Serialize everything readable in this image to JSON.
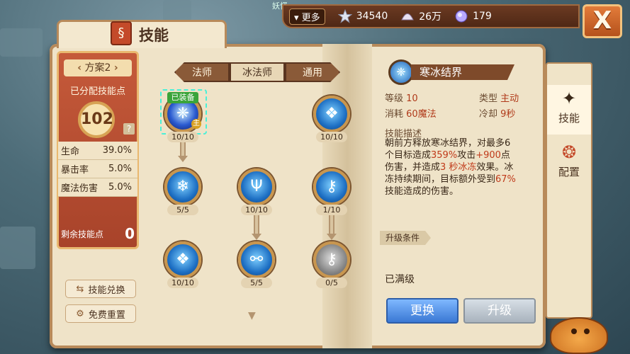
{
  "topbar": {
    "top_label": "妖怪",
    "more_label": "更多",
    "star_value": "34540",
    "shell_value": "26万",
    "gem_value": "179"
  },
  "window": {
    "title": "技能",
    "close_label": "X"
  },
  "left": {
    "plan_label": "方案2",
    "assigned_label": "已分配技能点",
    "assigned_points": "102",
    "help_label": "?",
    "stats": [
      {
        "name": "生命",
        "value": "39.0%"
      },
      {
        "name": "暴击率",
        "value": "5.0%"
      },
      {
        "name": "魔法伤害",
        "value": "5.0%"
      }
    ],
    "remaining_label": "剩余技能点",
    "remaining_value": "0",
    "exchange_label": "技能兑换",
    "reset_label": "免费重置"
  },
  "tabs": [
    "法师",
    "冰法师",
    "通用"
  ],
  "tree": {
    "equipped_tag": "已装备",
    "main_tag": "主",
    "levels": [
      "10/10",
      "10/10",
      "5/5",
      "10/10",
      "1/10",
      "10/10",
      "5/5",
      "0/5"
    ]
  },
  "detail": {
    "name": "寒冰结界",
    "level_label": "等级",
    "level_value": "10",
    "type_label": "类型",
    "type_value": "主动",
    "cost_label": "消耗",
    "cost_value": "60魔法",
    "cooldown_label": "冷却",
    "cooldown_value": "9秒",
    "desc_title": "技能描述",
    "desc_parts": {
      "p1": "朝前方释放寒冰结界，对最多6个目标造成",
      "r1": "359%",
      "p2": "攻击",
      "r2": "+900",
      "p3": "点伤害，并造成",
      "r3": "3 秒冰冻",
      "p4": "效果。冰冻持续期间，目标额外受到",
      "r4": "67%",
      "p5": "技能造成的伤害。"
    },
    "upgrade_cond_label": "升级条件",
    "maxed_label": "已满级",
    "swap_label": "更换",
    "upgrade_label": "升级"
  },
  "side_tabs": [
    {
      "label": "技能",
      "icon": "skill-icon"
    },
    {
      "label": "配置",
      "icon": "config-icon"
    }
  ]
}
